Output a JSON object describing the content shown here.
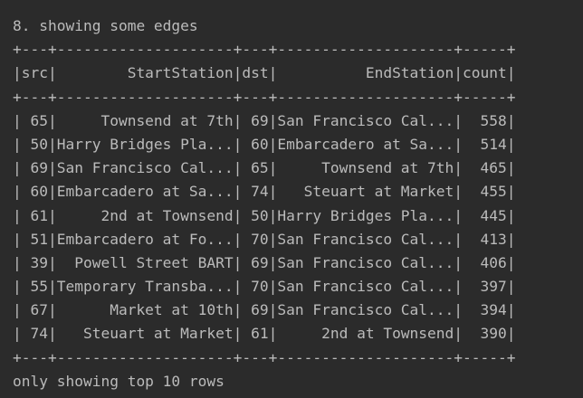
{
  "console": {
    "heading": "8. showing some edges",
    "border": "+---+--------------------+---+--------------------+-----+",
    "header_row": "|src|        StartStation|dst|          EndStation|count|",
    "rows": [
      "| 65|     Townsend at 7th| 69|San Francisco Cal...|  558|",
      "| 50|Harry Bridges Pla...| 60|Embarcadero at Sa...|  514|",
      "| 69|San Francisco Cal...| 65|     Townsend at 7th|  465|",
      "| 60|Embarcadero at Sa...| 74|   Steuart at Market|  455|",
      "| 61|     2nd at Townsend| 50|Harry Bridges Pla...|  445|",
      "| 51|Embarcadero at Fo...| 70|San Francisco Cal...|  413|",
      "| 39|  Powell Street BART| 69|San Francisco Cal...|  406|",
      "| 55|Temporary Transba...| 70|San Francisco Cal...|  397|",
      "| 67|      Market at 10th| 69|San Francisco Cal...|  394|",
      "| 74|   Steuart at Market| 61|     2nd at Townsend|  390|"
    ],
    "footer": "only showing top 10 rows"
  },
  "colors": {
    "background": "#2b2b2b",
    "text": "#bbbbbb"
  }
}
